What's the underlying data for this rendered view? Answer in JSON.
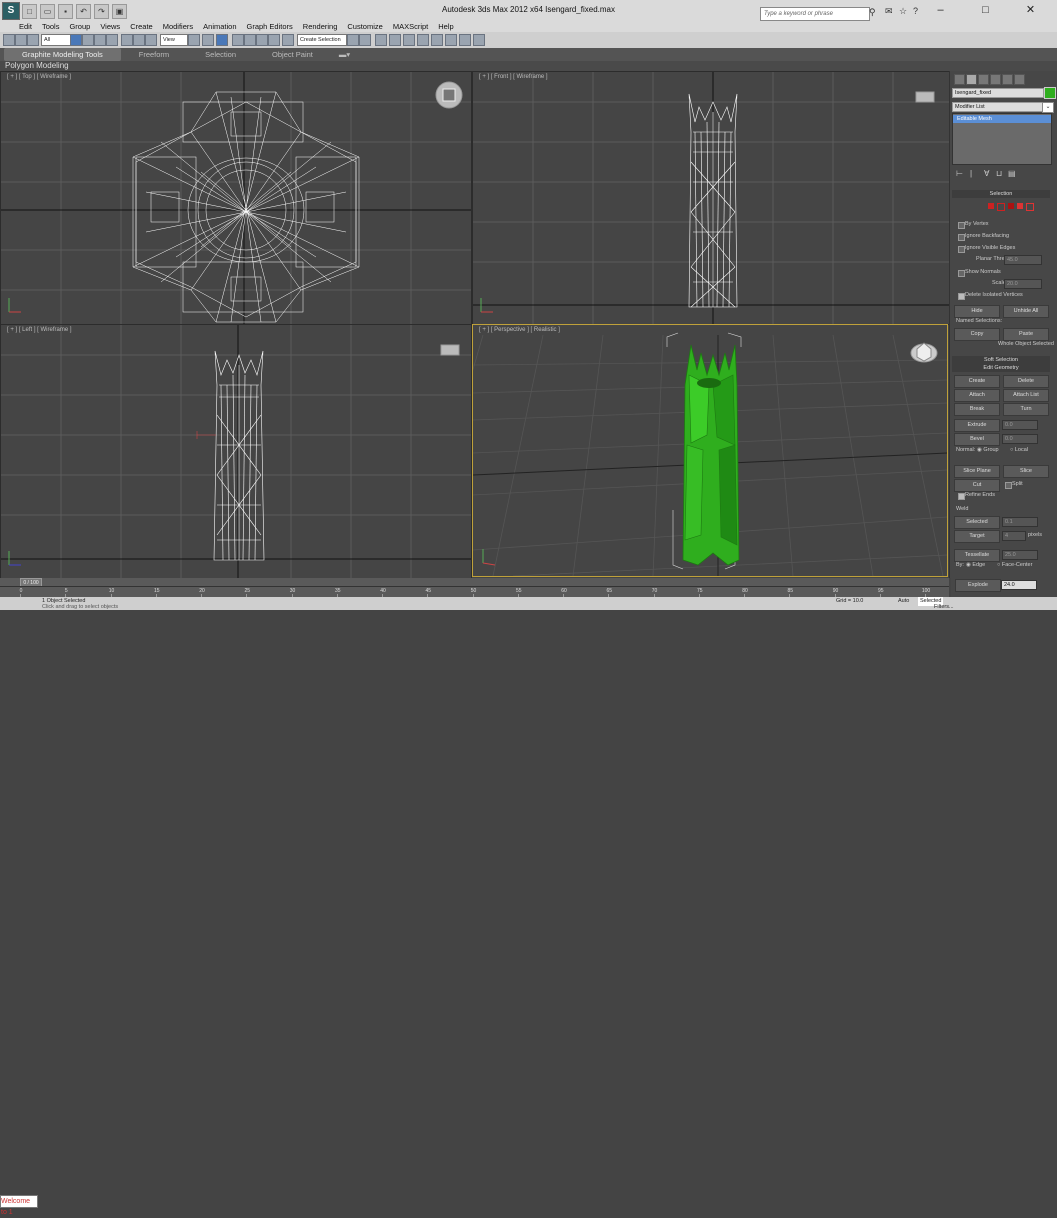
{
  "window": {
    "title": "Autodesk 3ds Max  2012 x64      Isengard_fixed.max",
    "app_icon": "S",
    "search_placeholder": "Type a keyword or phrase",
    "controls": [
      "–",
      "□",
      "✕"
    ]
  },
  "menu": [
    "Edit",
    "Tools",
    "Group",
    "Views",
    "Create",
    "Modifiers",
    "Animation",
    "Graph Editors",
    "Rendering",
    "Customize",
    "MAXScript",
    "Help"
  ],
  "toolbar": {
    "filter_value": "All",
    "coord_value": "View",
    "selection_set": "Create Selection"
  },
  "ribbon": {
    "tabs": [
      "Graphite Modeling Tools",
      "Freeform",
      "Selection",
      "Object Paint"
    ],
    "sub_label": "Polygon Modeling"
  },
  "viewports": {
    "top": "[ + ] [ Top ] [ Wireframe ]",
    "front": "[ + ] [ Front ] [ Wireframe ]",
    "left": "[ + ] [ Left ] [ Wireframe ]",
    "persp": "[ + ] [ Perspective ] [ Realistic ]"
  },
  "colors": {
    "viewport_bg": "#454545",
    "grid": "#5e5e5e",
    "wire": "#ffffff",
    "model_green": "#2fae1e",
    "active_border": "#bfa13a"
  },
  "command_panel": {
    "object_name": "Isengard_fixed",
    "modifier_list": "Modifier List",
    "stack_item": "Editable Mesh",
    "selection_rollout": "Selection",
    "by_vertex": "By Vertex",
    "ignore_backfacing": "Ignore Backfacing",
    "ignore_visible_edges": "Ignore Visible Edges",
    "planar_thresh_label": "Planar Thresh:",
    "planar_thresh_value": "45.0",
    "show_normals": "Show Normals",
    "scale_label": "Scale:",
    "scale_value": "20.0",
    "delete_isolated": "Delete Isolated Vertices",
    "hide": "Hide",
    "unhide_all": "Unhide All",
    "named_selections": "Named Selections:",
    "copy": "Copy",
    "paste": "Paste",
    "whole_object": "Whole Object Selected",
    "soft_selection": "Soft Selection",
    "edit_geometry": "Edit Geometry",
    "create": "Create",
    "delete": "Delete",
    "attach": "Attach",
    "attach_list": "Attach List",
    "break": "Break",
    "turn": "Turn",
    "extrude": "Extrude",
    "extrude_value": "0.0",
    "bevel": "Bevel",
    "bevel_value": "0.0",
    "normal_label": "Normal:",
    "group": "Group",
    "local": "Local",
    "slice_plane": "Slice Plane",
    "slice": "Slice",
    "split": "Split",
    "cut": "Cut",
    "refine_ends": "Refine Ends",
    "weld": "Weld",
    "selected": "Selected",
    "selected_value": "0.1",
    "target": "Target",
    "target_value": "4",
    "pixels": "pixels",
    "tessellate": "Tessellate",
    "tess_value": "25.0",
    "by_label": "By:",
    "edge": "Edge",
    "face_center": "Face-Center",
    "explode": "Explode",
    "explode_value": "24.0"
  },
  "timeline": {
    "slider": "0 / 100",
    "ticks": [
      "0",
      "5",
      "10",
      "15",
      "20",
      "25",
      "30",
      "35",
      "40",
      "45",
      "50",
      "55",
      "60",
      "65",
      "70",
      "75",
      "80",
      "85",
      "90",
      "95",
      "100"
    ]
  },
  "status": {
    "maxscript": "Welcome to 1",
    "objects_selected": "1 Object Selected",
    "prompt": "Click and drag to select objects",
    "grid": "Grid = 10.0",
    "auto": "Auto",
    "selected": "Selected",
    "filters": "Filters..."
  }
}
